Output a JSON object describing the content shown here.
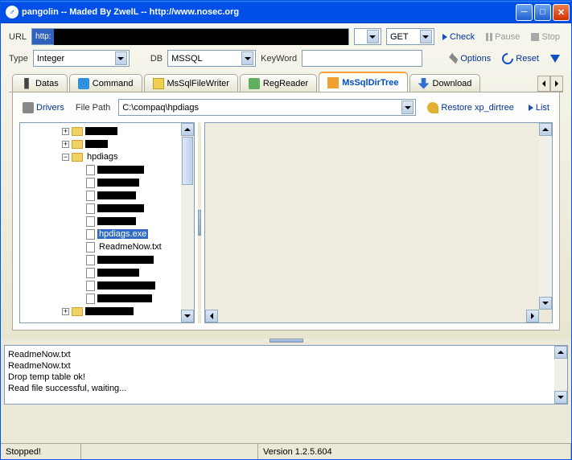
{
  "window": {
    "title": "pangolin -- Maded By ZwelL -- http://www.nosec.org"
  },
  "toolbar": {
    "url_label": "URL",
    "url_proto": "http:",
    "method": "GET",
    "check": "Check",
    "pause": "Pause",
    "stop": "Stop",
    "type_label": "Type",
    "type_value": "Integer",
    "db_label": "DB",
    "db_value": "MSSQL",
    "keyword_label": "KeyWord",
    "options": "Options",
    "reset": "Reset"
  },
  "tabs": {
    "datas": "Datas",
    "command": "Command",
    "filewriter": "MsSqlFileWriter",
    "regreader": "RegReader",
    "dirtree": "MsSqlDirTree",
    "download": "Download"
  },
  "dirtree": {
    "drivers": "Drivers",
    "filepath_label": "File Path",
    "filepath_value": "C:\\compaq\\hpdiags",
    "restore": "Restore xp_dirtree",
    "list": "List"
  },
  "tree": {
    "folder_hpdiags": "hpdiags",
    "file_selected": "hpdiags.exe",
    "file_readme1": "ReadmeNow.txt"
  },
  "output": {
    "l1": "ReadmeNow.txt",
    "l2": "ReadmeNow.txt",
    "l3": "Drop temp table ok!",
    "l4": "Read file successful, waiting..."
  },
  "status": {
    "left": "Stopped!",
    "version": "Version  1.2.5.604"
  }
}
